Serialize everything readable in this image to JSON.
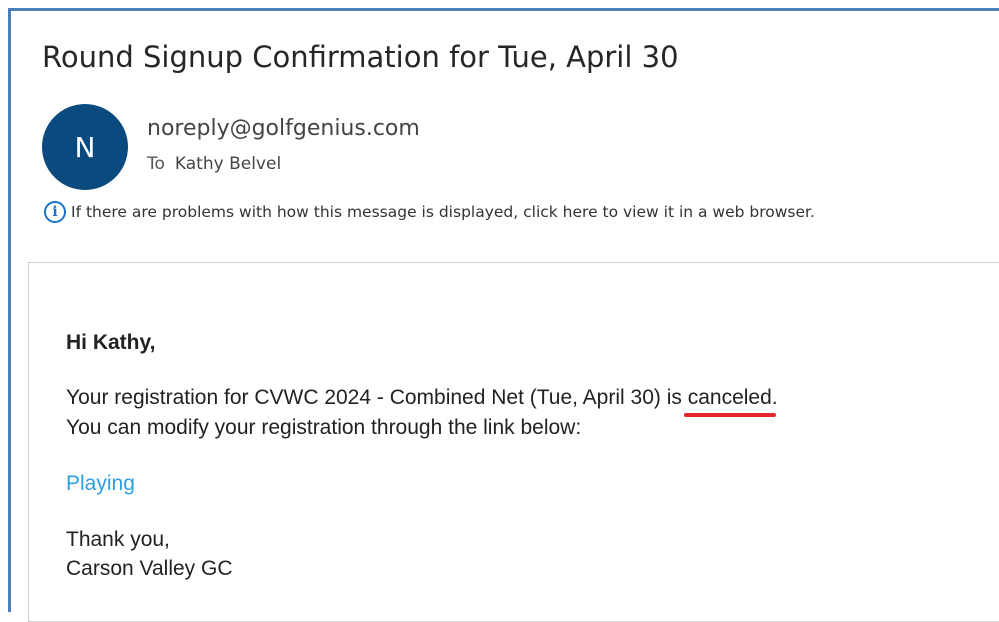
{
  "email": {
    "subject": "Round Signup Confirmation for Tue, April 30",
    "avatar_initial": "N",
    "sender": "noreply@golfgenius.com",
    "to_label": "To",
    "recipient": "Kathy Belvel",
    "info_notice": "If there are problems with how this message is displayed, click here to view it in a web browser."
  },
  "message": {
    "greeting": "Hi Kathy,",
    "registration_text_before": "Your registration for CVWC 2024 - Combined Net (Tue, April 30) is ",
    "status_word": "canceled",
    "registration_text_after": ".",
    "modify_text": "You can modify your registration through the link below:",
    "link_label": "Playing",
    "closing": "Thank you,",
    "signature": "Carson Valley GC"
  },
  "colors": {
    "frame": "#4a7fba",
    "avatar_bg": "#0b4a7f",
    "link": "#2e9fe0",
    "annotation_underline": "#e0252b"
  },
  "icons": {
    "info": "info-circle-icon"
  }
}
